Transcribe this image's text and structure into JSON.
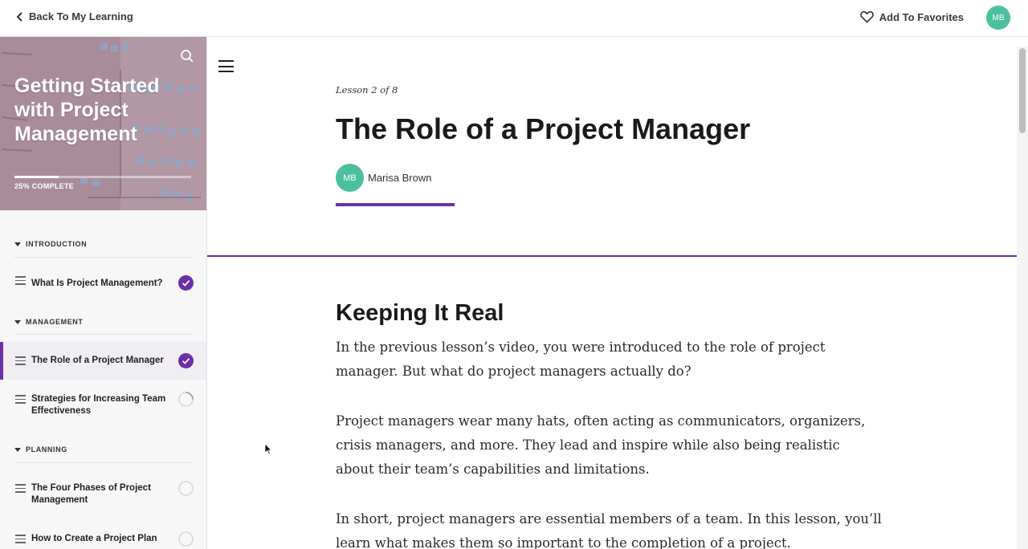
{
  "topbar": {
    "back_label": "Back To My Learning",
    "favorites_label": "Add To Favorites",
    "user_initials": "MB"
  },
  "sidebar": {
    "course_title": "Getting Started with Project Management",
    "progress_label": "25% COMPLETE",
    "progress_value": 0.25,
    "sections": [
      {
        "title": "INTRODUCTION",
        "lessons": [
          {
            "label": "What Is Project Management?",
            "status": "complete"
          }
        ]
      },
      {
        "title": "MANAGEMENT",
        "lessons": [
          {
            "label": "The Role of a Project Manager",
            "status": "complete",
            "active": true
          },
          {
            "label": "Strategies for Increasing Team Effectiveness",
            "status": "in-progress"
          }
        ]
      },
      {
        "title": "PLANNING",
        "lessons": [
          {
            "label": "The Four Phases of Project Management",
            "status": "not-started"
          },
          {
            "label": "How to Create a Project Plan",
            "status": "not-started"
          }
        ]
      }
    ]
  },
  "lesson": {
    "count_label": "Lesson 2 of 8",
    "title": "The Role of a Project Manager",
    "author_initials": "MB",
    "author_name": "Marisa Brown"
  },
  "content": {
    "heading": "Keeping It Real",
    "paragraphs": [
      "In the previous lesson’s video, you were introduced to the role of project manager. But what do project managers actually do?",
      "Project managers wear many hats, often acting as communicators, organizers, crisis managers, and more. They lead and inspire while also being realistic about their team’s capabilities and limitations.",
      "In short, project managers are essential members of a team. In this lesson, you’ll learn what makes them so important to the completion of a project."
    ]
  },
  "colors": {
    "accent": "#6b2fa6",
    "avatar": "#4cbf9f"
  }
}
